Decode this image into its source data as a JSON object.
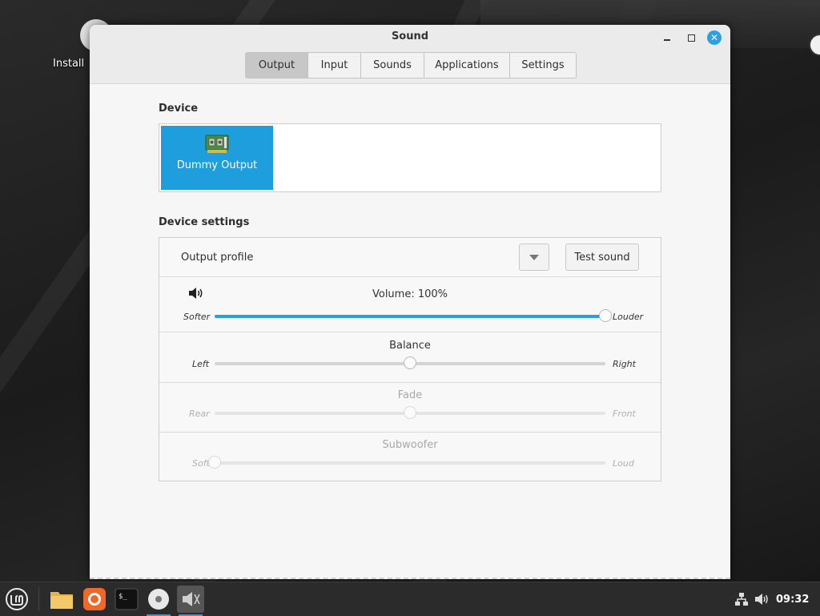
{
  "desktop": {
    "install_label": "Install"
  },
  "window": {
    "title": "Sound",
    "tabs": [
      {
        "label": "Output",
        "active": true
      },
      {
        "label": "Input",
        "active": false
      },
      {
        "label": "Sounds",
        "active": false
      },
      {
        "label": "Applications",
        "active": false
      },
      {
        "label": "Settings",
        "active": false
      }
    ]
  },
  "device": {
    "section_title": "Device",
    "items": [
      {
        "name": "Dummy Output",
        "icon": "sound-card-icon",
        "selected": true
      }
    ]
  },
  "device_settings": {
    "section_title": "Device settings",
    "output_profile_label": "Output profile",
    "test_sound_label": "Test sound",
    "sliders": [
      {
        "id": "volume",
        "title": "Volume: 100%",
        "low_label": "Softer",
        "high_label": "Louder",
        "value_fraction": 1.0,
        "enabled": true,
        "filled": true
      },
      {
        "id": "balance",
        "title": "Balance",
        "low_label": "Left",
        "high_label": "Right",
        "value_fraction": 0.5,
        "enabled": true,
        "filled": false
      },
      {
        "id": "fade",
        "title": "Fade",
        "low_label": "Rear",
        "high_label": "Front",
        "value_fraction": 0.5,
        "enabled": false,
        "filled": false
      },
      {
        "id": "subwoofer",
        "title": "Subwoofer",
        "low_label": "Soft",
        "high_label": "Loud",
        "value_fraction": 0.0,
        "enabled": false,
        "filled": false
      }
    ]
  },
  "taskbar": {
    "clock": "09:32",
    "accent_color": "#2f9fe0",
    "launchers": [
      "mint-menu-icon",
      "files-icon",
      "firefox-icon",
      "terminal-icon",
      "disc-icon",
      "sound-settings-icon"
    ]
  }
}
